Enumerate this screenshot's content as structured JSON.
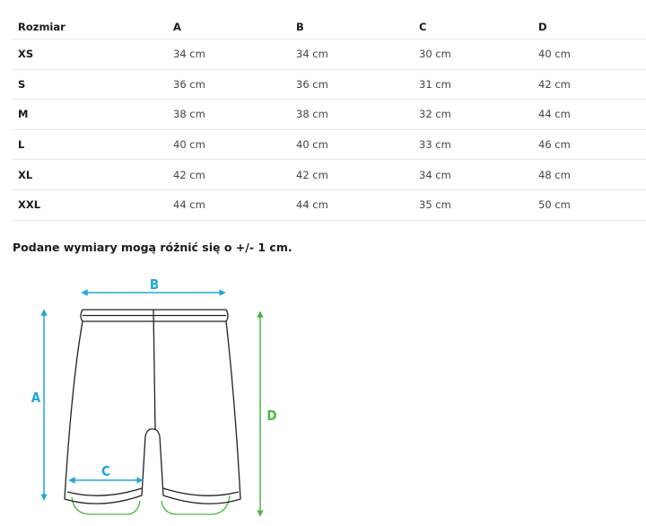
{
  "table": {
    "headers": [
      "Rozmiar",
      "A",
      "B",
      "C",
      "D"
    ],
    "rows": [
      {
        "size": "XS",
        "values": [
          "34 cm",
          "34 cm",
          "30 cm",
          "40 cm"
        ]
      },
      {
        "size": "S",
        "values": [
          "36 cm",
          "36 cm",
          "31 cm",
          "42 cm"
        ]
      },
      {
        "size": "M",
        "values": [
          "38 cm",
          "38 cm",
          "32 cm",
          "44 cm"
        ]
      },
      {
        "size": "L",
        "values": [
          "40 cm",
          "40 cm",
          "33 cm",
          "46 cm"
        ]
      },
      {
        "size": "XL",
        "values": [
          "42 cm",
          "42 cm",
          "34 cm",
          "48 cm"
        ]
      },
      {
        "size": "XXL",
        "values": [
          "44 cm",
          "44 cm",
          "35 cm",
          "50 cm"
        ]
      }
    ]
  },
  "note": "Podane wymiary mogą różnić się o +/- 1 cm.",
  "diagram": {
    "labels": {
      "a": "A",
      "b": "B",
      "c": "C",
      "d": "D"
    },
    "colors": {
      "blue": "#1ea7d8",
      "green": "#4cb648",
      "outline": "#222222"
    },
    "icons": [
      "shorts-outline-icon"
    ]
  }
}
